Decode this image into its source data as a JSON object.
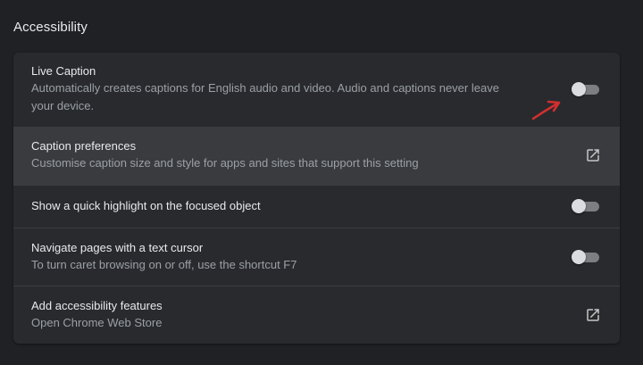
{
  "section": {
    "title": "Accessibility"
  },
  "rows": [
    {
      "title": "Live Caption",
      "subtitle": "Automatically creates captions for English audio and video. Audio and captions never leave your device.",
      "control": "toggle",
      "enabled": false
    },
    {
      "title": "Caption preferences",
      "subtitle": "Customise caption size and style for apps and sites that support this setting",
      "control": "external-link-icon"
    },
    {
      "title": "Show a quick highlight on the focused object",
      "control": "toggle",
      "enabled": false
    },
    {
      "title": "Navigate pages with a text cursor",
      "subtitle": "To turn caret browsing on or off, use the shortcut F7",
      "control": "toggle",
      "enabled": false
    },
    {
      "title": "Add accessibility features",
      "subtitle": "Open Chrome Web Store",
      "control": "external-link-icon"
    }
  ],
  "colors": {
    "background": "#202124",
    "card": "#292a2d",
    "hover_row": "#3a3b3e",
    "annotation_arrow": "#d32f2f"
  }
}
